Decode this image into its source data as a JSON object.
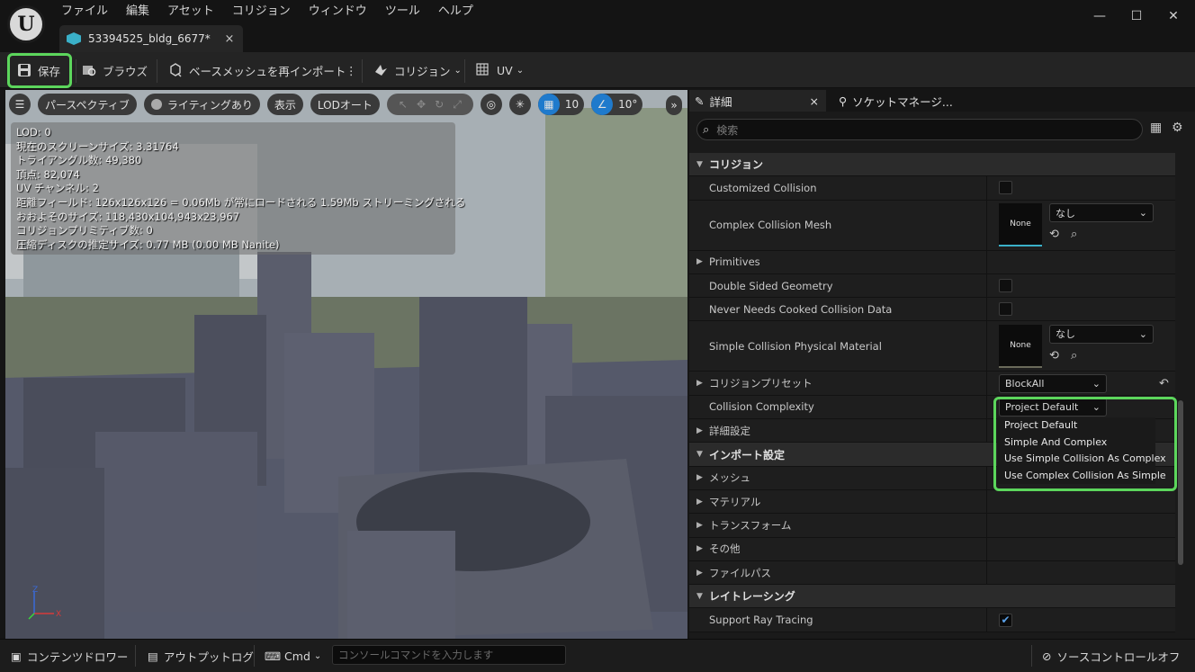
{
  "menu": [
    "ファイル",
    "編集",
    "アセット",
    "コリジョン",
    "ウィンドウ",
    "ツール",
    "ヘルプ"
  ],
  "document_tab": {
    "title": "53394525_bldg_6677*",
    "close": "×"
  },
  "window_controls": {
    "minimize": "—",
    "maximize": "☐",
    "close": "✕"
  },
  "toolbar": {
    "save": "保存",
    "browse": "ブラウズ",
    "reimport": "ベースメッシュを再インポート",
    "more": "⋮",
    "collision": "コリジョン",
    "uv": "UV"
  },
  "viewport": {
    "perspective": "パースペクティブ",
    "lighting": "ライティングあり",
    "show": "表示",
    "lod": "LODオート",
    "grid_value": "10",
    "angle_value": "10°",
    "more": "»",
    "stats": [
      "LOD: 0",
      "現在のスクリーンサイズ: 3.31764",
      "トライアングル数: 49,380",
      "頂点: 82,074",
      "UV チャンネル: 2",
      "距離フィールド: 126x126x126 = 0.06Mb が常にロードされる 1.59Mb ストリーミングされる",
      "おおよそのサイズ: 118,430x104,943x23,967",
      "コリジョンプリミティブ数: 0",
      "圧縮ディスクの推定サイズ: 0.77 MB (0.00 MB Nanite)"
    ],
    "axis": {
      "z": "Z",
      "x": "X"
    }
  },
  "details": {
    "tab_details": "詳細",
    "tab_socket": "ソケットマネージ...",
    "close": "×",
    "search_placeholder": "検索",
    "rows": {
      "collision_cat": "コリジョン",
      "customized": "Customized Collision",
      "complex_mesh": "Complex Collision Mesh",
      "primitives": "Primitives",
      "double_sided": "Double Sided Geometry",
      "never_cooked": "Never Needs Cooked Collision Data",
      "simple_phys": "Simple Collision Physical Material",
      "preset": "コリジョンプリセット",
      "complexity": "Collision Complexity",
      "advanced": "詳細設定",
      "import_cat": "インポート設定",
      "mesh": "メッシュ",
      "material": "マテリアル",
      "transform": "トランスフォーム",
      "other": "その他",
      "filepath": "ファイルパス",
      "raytracing_cat": "レイトレーシング",
      "support_rt": "Support Ray Tracing"
    },
    "none_thumb": "None",
    "none_combo": "なし",
    "preset_value": "BlockAll",
    "complexity_value": "Project Default",
    "reset": "↶"
  },
  "dropdown_options": [
    "Project Default",
    "Simple And Complex",
    "Use Simple Collision As Complex",
    "Use Complex Collision As Simple"
  ],
  "statusbar": {
    "content_drawer": "コンテンツドロワー",
    "output_log": "アウトプットログ",
    "cmd": "Cmd",
    "console_placeholder": "コンソールコマンドを入力します",
    "source_control": "ソースコントロールオフ"
  },
  "colors": {
    "highlight": "#5cd65c",
    "accent_blue": "#1f7acc",
    "mesh_cyan": "#3ab0c8"
  }
}
